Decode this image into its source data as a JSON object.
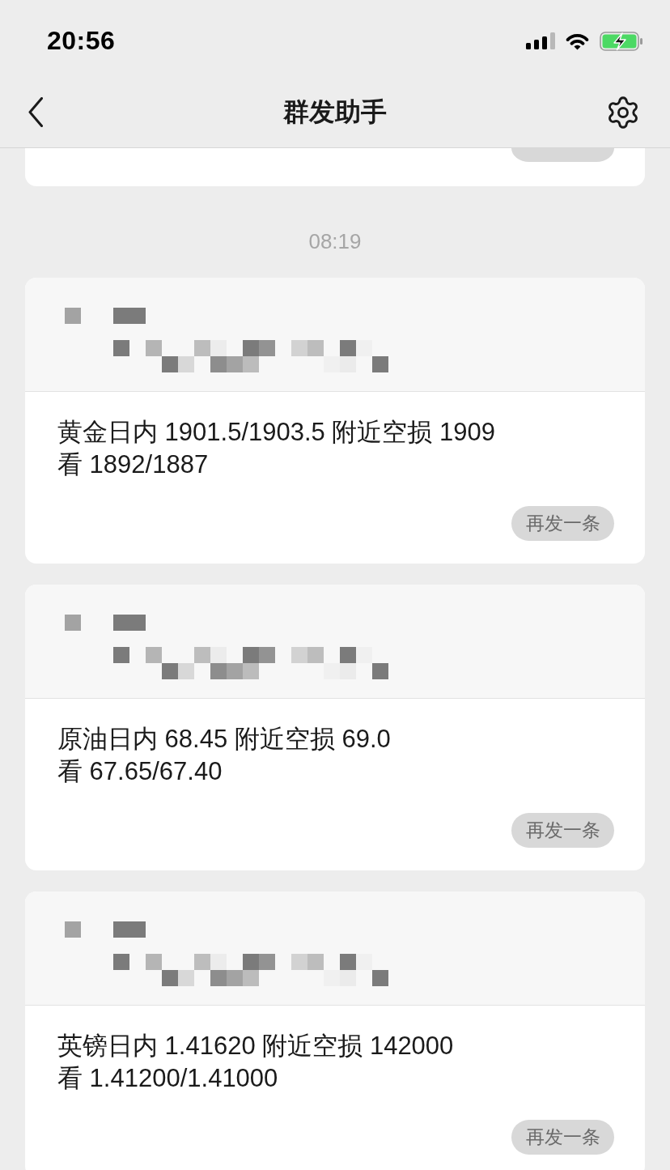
{
  "status_bar": {
    "time": "20:56"
  },
  "nav_bar": {
    "title": "群发助手"
  },
  "feed": [
    {
      "kind": "cut_card"
    },
    {
      "kind": "time",
      "text": "08:19"
    },
    {
      "kind": "message",
      "text": "黄金日内 1901.5/1903.5 附近空损 1909\n看 1892/1887",
      "button": "再发一条"
    },
    {
      "kind": "message",
      "text": "原油日内 68.45 附近空损 69.0\n看 67.65/67.40",
      "button": "再发一条"
    },
    {
      "kind": "message",
      "text": "英镑日内 1.41620 附近空损 142000\n看 1.41200/1.41000",
      "button": "再发一条"
    }
  ]
}
